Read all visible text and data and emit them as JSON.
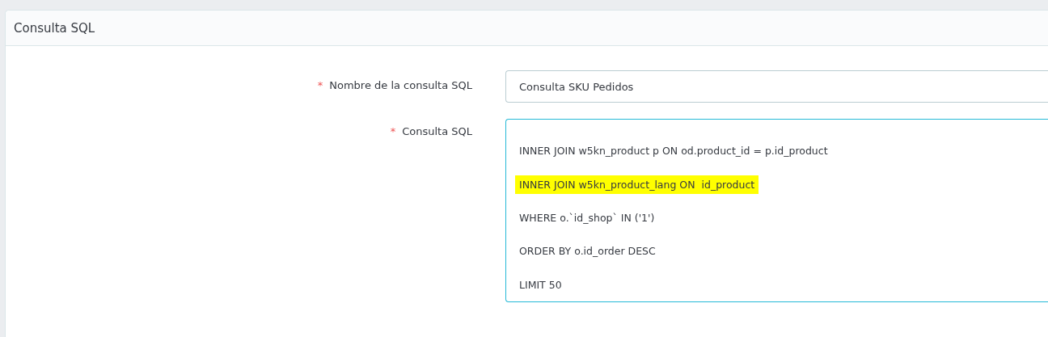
{
  "panel": {
    "title": "Consulta SQL"
  },
  "fields": [
    {
      "kind": "input",
      "label": "Nombre de la consulta SQL",
      "required_mark": "*",
      "value": "Consulta SKU Pedidos",
      "focused": false
    },
    {
      "kind": "textarea",
      "label": "Consulta SQL",
      "required_mark": "*",
      "focused": true,
      "lines": [
        {
          "text": "INNER JOIN w5kn_product p ON od.product_id = p.id_product",
          "highlighted": false
        },
        {
          "text": "INNER JOIN w5kn_product_lang ON  id_product",
          "highlighted": true
        },
        {
          "text": "WHERE o.`id_shop` IN ('1')",
          "highlighted": false
        },
        {
          "text": "ORDER BY o.id_order DESC",
          "highlighted": false
        },
        {
          "text": "LIMIT 50",
          "highlighted": false
        }
      ]
    }
  ]
}
